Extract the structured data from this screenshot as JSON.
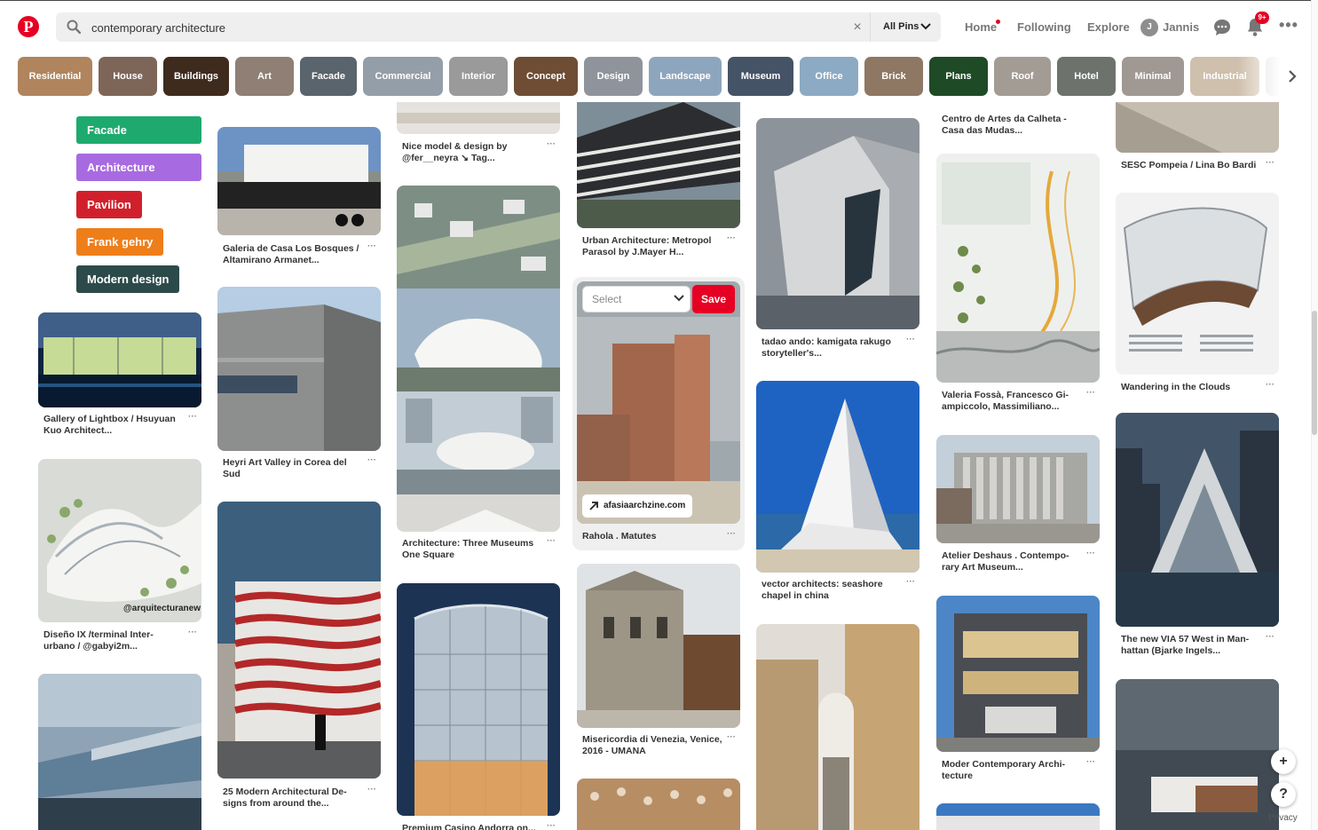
{
  "header": {
    "logo": "P",
    "search": {
      "value": "contemporary architecture",
      "clear": "×",
      "scope": "All Pins"
    },
    "nav": {
      "home": "Home",
      "following": "Following",
      "explore": "Explore",
      "profile": "Jannis",
      "avatar_initial": "J"
    },
    "notification_badge": "9+",
    "more": "•••"
  },
  "guides": [
    {
      "label": "Residential",
      "color": "#b0845d"
    },
    {
      "label": "House",
      "color": "#7d6658"
    },
    {
      "label": "Buildings",
      "color": "#3f2b1e"
    },
    {
      "label": "Art",
      "color": "#8f7f74"
    },
    {
      "label": "Facade",
      "color": "#5a646c"
    },
    {
      "label": "Commercial",
      "color": "#949ea8"
    },
    {
      "label": "Interior",
      "color": "#9a9a9a"
    },
    {
      "label": "Concept",
      "color": "#6e4d34"
    },
    {
      "label": "Design",
      "color": "#8f949c"
    },
    {
      "label": "Landscape",
      "color": "#8ea6bd"
    },
    {
      "label": "Museum",
      "color": "#455366"
    },
    {
      "label": "Office",
      "color": "#8caac4"
    },
    {
      "label": "Brick",
      "color": "#8e7763"
    },
    {
      "label": "Plans",
      "color": "#1f4a26"
    },
    {
      "label": "Roof",
      "color": "#a39c95"
    },
    {
      "label": "Hotel",
      "color": "#6d726d"
    },
    {
      "label": "Minimal",
      "color": "#a09893"
    },
    {
      "label": "Industrial",
      "color": "#cfc0ad"
    },
    {
      "label": "Sc",
      "color": "#d8d8de"
    }
  ],
  "tags": [
    {
      "label": "Facade architecture",
      "color": "#1eaa6e"
    },
    {
      "label": "Architecture design",
      "color": "#a86ae0"
    },
    {
      "label": "Pavilion",
      "color": "#d1202b"
    },
    {
      "label": "Frank gehry",
      "color": "#ee7e1a"
    },
    {
      "label": "Modern design",
      "color": "#2d4a4a"
    }
  ],
  "pins": {
    "col1": [
      {
        "title": "Gallery of Lightbox / Hsuyuan Kuo Architect..."
      },
      {
        "title": "Diseño IX /terminal Inter-urbano / @gabyi2m...",
        "watermark": "@arquitecturanew"
      },
      {
        "title": ""
      }
    ],
    "col2": [
      {
        "title": "Galeria de Casa Los Bosques / Altamirano Armanet..."
      },
      {
        "title": "Heyri Art Valley in Corea del Sud"
      },
      {
        "title": "25 Modern Architectural De-signs from around the..."
      }
    ],
    "col3": [
      {
        "title": "Nice model & design by @fer__neyra ↘ Tag..."
      },
      {
        "title": "Architecture: Three Museums One Square"
      },
      {
        "title": "Premium Casino Andorra on..."
      }
    ],
    "col4": [
      {
        "title": "Urban Architecture: Metropol Parasol by J.Mayer H..."
      },
      {
        "title": "Rahola . Matutes",
        "select": "Select",
        "save": "Save",
        "source": "afasiaarchzine.com"
      },
      {
        "title": "Misericordia di Venezia, Venice, 2016 - UMANA"
      },
      {
        "title": ""
      }
    ],
    "col5": [
      {
        "title": "tadao ando: kamigata rakugo storyteller's..."
      },
      {
        "title": "vector architects: seashore chapel in china"
      },
      {
        "title": ""
      }
    ],
    "col6": [
      {
        "title": "Centro de Artes da Calheta - Casa das Mudas..."
      },
      {
        "title": "Valeria Fossà, Francesco Gi-ampiccolo, Massimiliano..."
      },
      {
        "title": "Atelier Deshaus . Contempo-rary Art Museum..."
      },
      {
        "title": "Moder Contemporary Archi-tecture"
      },
      {
        "title": ""
      }
    ],
    "col7": [
      {
        "title": "SESC Pompeia / Lina Bo Bardi"
      },
      {
        "title": "Wandering in the Clouds"
      },
      {
        "title": "The new VIA 57 West in Man-hattan (Bjarke Ingels..."
      },
      {
        "title": ""
      }
    ],
    "more": "···"
  },
  "controls": {
    "add": "+",
    "help": "?",
    "privacy": "Privacy"
  }
}
